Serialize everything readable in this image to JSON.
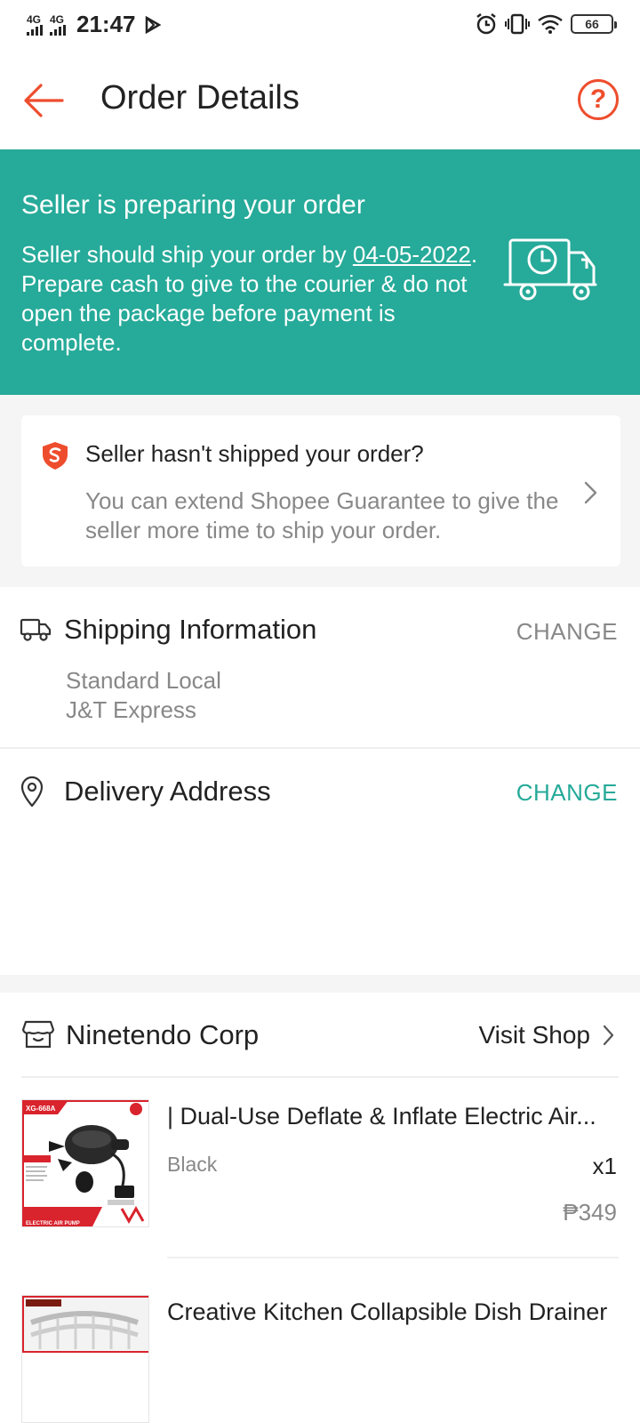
{
  "status_bar": {
    "network_1": "4G",
    "network_2": "4G",
    "time": "21:47",
    "battery": "66"
  },
  "header": {
    "title": "Order Details"
  },
  "banner": {
    "title": "Seller is preparing your order",
    "text_before_date": "Seller should ship your order by ",
    "ship_by_date": "04-05-2022",
    "text_after_date": ". Prepare cash to give to the courier & do not open the package before payment is complete.",
    "color": "#26aa99"
  },
  "guarantee": {
    "title": "Seller hasn't shipped your order?",
    "description": "You can extend Shopee Guarantee to give the seller more time to ship your order."
  },
  "shipping": {
    "title": "Shipping Information",
    "change_label": "CHANGE",
    "method": "Standard Local",
    "carrier": "J&T Express"
  },
  "delivery": {
    "title": "Delivery Address",
    "change_label": "CHANGE"
  },
  "shop": {
    "name": "Ninetendo Corp",
    "visit_label": "Visit Shop"
  },
  "products": [
    {
      "name": "| Dual-Use Deflate & Inflate Electric Air...",
      "variation": "Black",
      "quantity": "x1",
      "price": "₱349",
      "thumb_model": "XG-668A",
      "thumb_caption": "ELECTRIC AIR PUMP"
    },
    {
      "name": "Creative Kitchen Collapsible Dish Drainer"
    }
  ],
  "colors": {
    "brand": "#ee4d2d",
    "teal": "#26aa99"
  }
}
